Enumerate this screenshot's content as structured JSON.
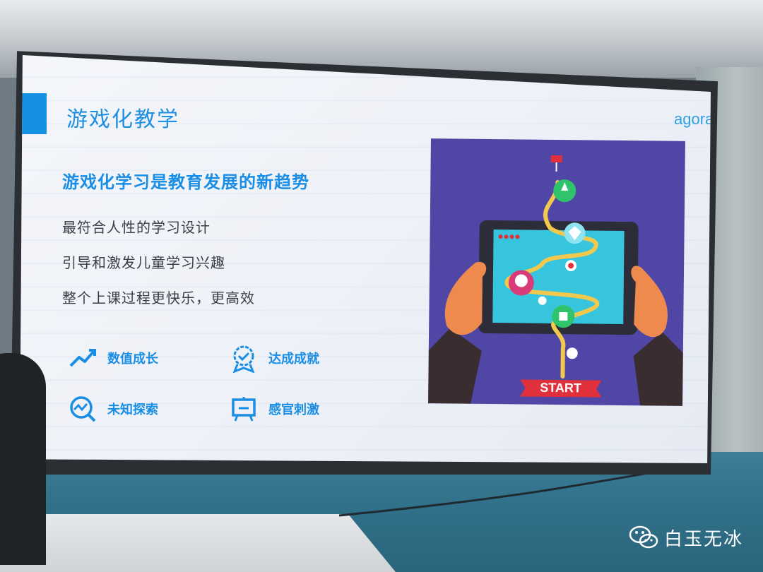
{
  "slide": {
    "title": "游戏化教学",
    "logo": "agora",
    "headline": "游戏化学习是教育发展的新趋势",
    "bullets": [
      "最符合人性的学习设计",
      "引导和激发儿童学习兴趣",
      "整个上课过程更快乐，更高效"
    ],
    "features": [
      {
        "label": "数值成长",
        "icon": "trend-up-icon"
      },
      {
        "label": "达成成就",
        "icon": "badge-icon"
      },
      {
        "label": "未知探索",
        "icon": "explore-icon"
      },
      {
        "label": "感官刺激",
        "icon": "screen-icon"
      }
    ],
    "illustration": {
      "start_label": "START"
    }
  },
  "watermark": {
    "text": "白玉无冰",
    "icon": "wechat-icon"
  },
  "colors": {
    "accent": "#1690e3",
    "illustration_bg": "#5046a6",
    "start_red": "#e0303b"
  }
}
